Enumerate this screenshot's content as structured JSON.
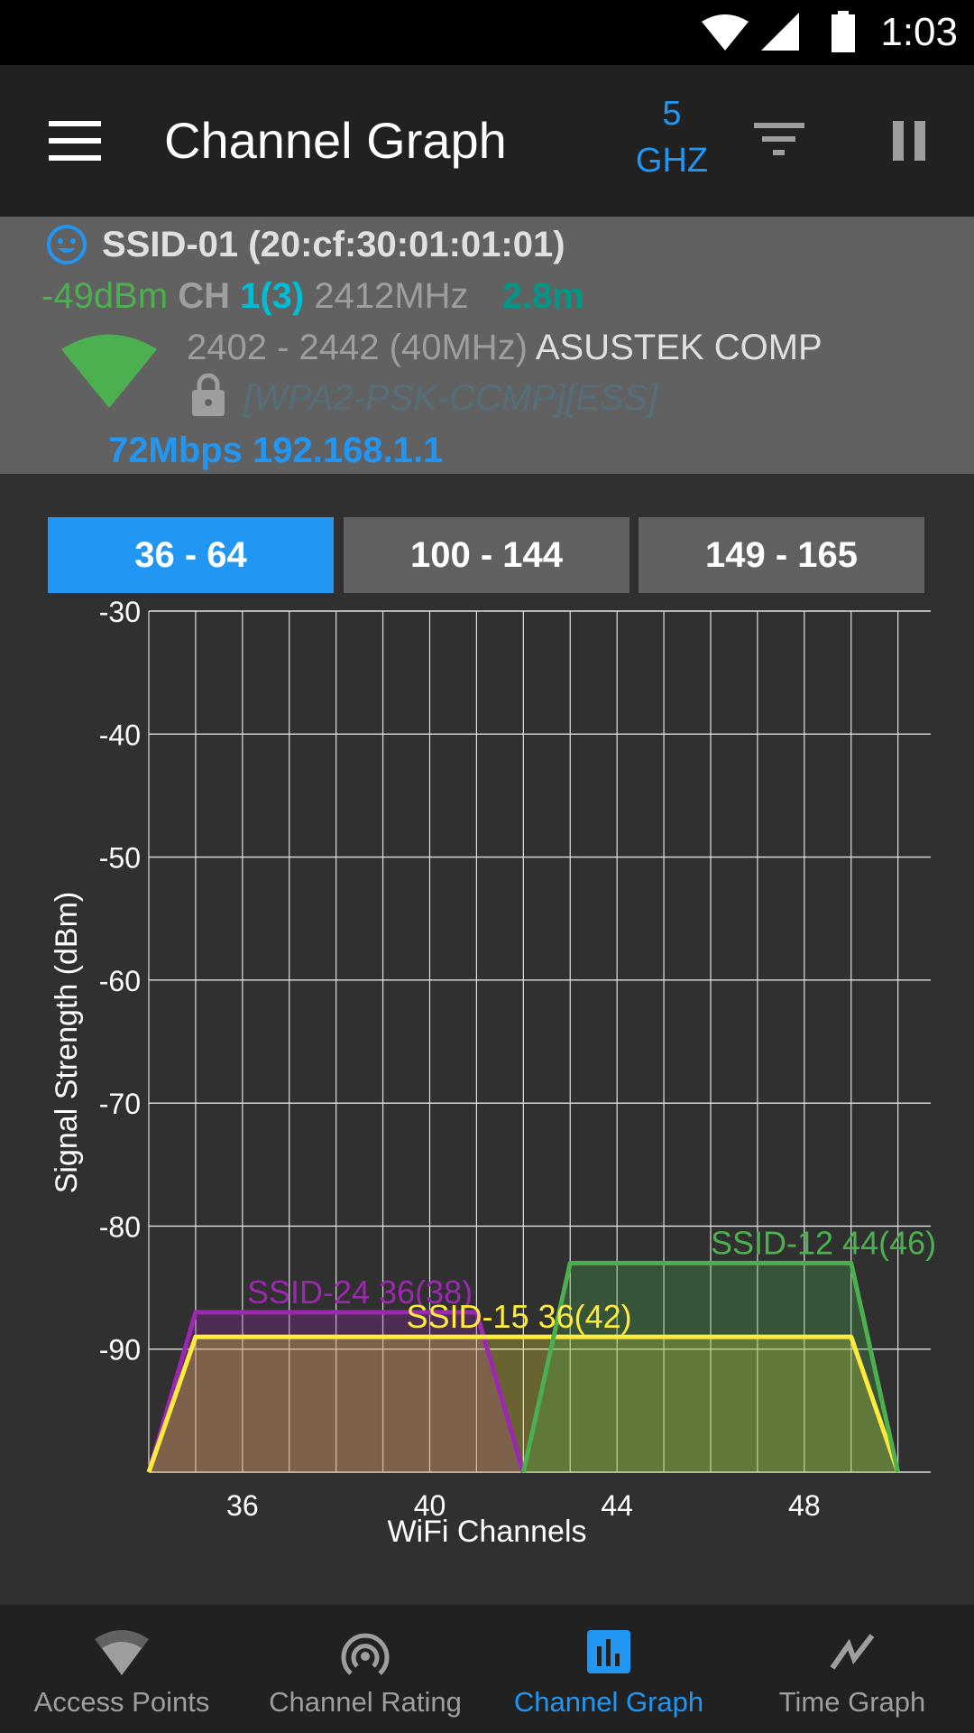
{
  "status_bar": {
    "time": "1:03",
    "icons": [
      "wifi-icon",
      "cell-signal-icon",
      "battery-icon"
    ]
  },
  "app_bar": {
    "title": "Channel Graph",
    "band_number": "5",
    "band_unit": "GHZ",
    "icons": [
      "menu-icon",
      "filter-icon",
      "pause-icon"
    ]
  },
  "connected_ap": {
    "ssid_line": "SSID-01 (20:cf:30:01:01:01)",
    "signal": "-49dBm",
    "ch_label": "CH",
    "channel": "1",
    "channel_secondary": "(3)",
    "frequency": "2412MHz",
    "distance": "2.8m",
    "range": "2402 - 2442 (40MHz)",
    "vendor": "ASUSTEK COMP",
    "security": "[WPA2-PSK-CCMP][ESS]",
    "link_speed": "72Mbps",
    "ip": "192.168.1.1",
    "colors": {
      "signal": "#4caf50",
      "channel": "#00bcd4",
      "distance": "#009688",
      "security": "#546e7a",
      "link": "#2196f3"
    }
  },
  "channel_tabs": [
    {
      "label": "36 - 64",
      "active": true
    },
    {
      "label": "100 - 144",
      "active": false
    },
    {
      "label": "149 - 165",
      "active": false
    }
  ],
  "chart_data": {
    "type": "area",
    "title": "",
    "xlabel": "WiFi Channels",
    "ylabel": "Signal Strength (dBm)",
    "xlim": [
      34,
      50.7
    ],
    "ylim": [
      -100,
      -30
    ],
    "x_ticks": [
      36,
      40,
      44,
      48
    ],
    "y_ticks": [
      -30,
      -40,
      -50,
      -60,
      -70,
      -80,
      -90
    ],
    "grid": true,
    "series": [
      {
        "name": "SSID-24 36(38)",
        "color": "#9c27b0",
        "points": [
          [
            34,
            -100
          ],
          [
            35,
            -87
          ],
          [
            41,
            -87
          ],
          [
            42,
            -100
          ]
        ],
        "label_at": [
          36.1,
          -87
        ]
      },
      {
        "name": "SSID-15 36(42)",
        "color": "#ffeb3b",
        "points": [
          [
            34,
            -100
          ],
          [
            35,
            -89
          ],
          [
            49,
            -89
          ],
          [
            50,
            -100
          ]
        ],
        "label_at": [
          39.5,
          -89
        ]
      },
      {
        "name": "SSID-12 44(46)",
        "color": "#4caf50",
        "points": [
          [
            42,
            -100
          ],
          [
            43,
            -83
          ],
          [
            49,
            -83
          ],
          [
            50,
            -100
          ]
        ],
        "label_at": [
          46,
          -83
        ]
      }
    ]
  },
  "bottom_nav": [
    {
      "label": "Access Points",
      "icon": "wifi-icon",
      "active": false
    },
    {
      "label": "Channel Rating",
      "icon": "radar-icon",
      "active": false
    },
    {
      "label": "Channel Graph",
      "icon": "bar-chart-icon",
      "active": true
    },
    {
      "label": "Time Graph",
      "icon": "line-graph-icon",
      "active": false
    }
  ]
}
